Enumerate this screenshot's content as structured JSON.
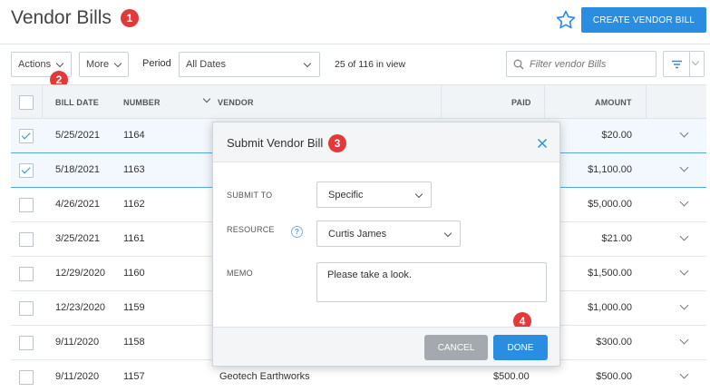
{
  "header": {
    "title": "Vendor Bills",
    "create_label": "CREATE VENDOR BILL",
    "icons": {
      "favorite": "star-icon"
    }
  },
  "badges": [
    "1",
    "2",
    "3",
    "4"
  ],
  "toolbar": {
    "actions_label": "Actions",
    "more_label": "More",
    "period_label": "Period",
    "period_value": "All Dates",
    "count_text": "25 of 116 in view",
    "search_placeholder": "Filter vendor Bills",
    "icons": {
      "search": "search-icon",
      "filter": "filter-icon"
    }
  },
  "table": {
    "columns": [
      "BILL DATE",
      "NUMBER",
      "VENDOR",
      "PAID",
      "AMOUNT"
    ],
    "rows": [
      {
        "date": "5/25/2021",
        "number": "1164",
        "vendor": "",
        "paid": "",
        "amount": "$20.00",
        "selected": true
      },
      {
        "date": "5/18/2021",
        "number": "1163",
        "vendor": "",
        "paid": "",
        "amount": "$1,100.00",
        "selected": true
      },
      {
        "date": "4/26/2021",
        "number": "1162",
        "vendor": "",
        "paid": "",
        "amount": "$5,000.00",
        "selected": false
      },
      {
        "date": "3/25/2021",
        "number": "1161",
        "vendor": "",
        "paid": "",
        "amount": "$21.00",
        "selected": false
      },
      {
        "date": "12/29/2020",
        "number": "1160",
        "vendor": "",
        "paid": "",
        "amount": "$1,500.00",
        "selected": false
      },
      {
        "date": "12/23/2020",
        "number": "1159",
        "vendor": "",
        "paid": "",
        "amount": "$1,000.00",
        "selected": false
      },
      {
        "date": "9/11/2020",
        "number": "1158",
        "vendor": "",
        "paid": "",
        "amount": "$300.00",
        "selected": false
      },
      {
        "date": "9/11/2020",
        "number": "1157",
        "vendor": "Geotech Earthworks",
        "paid": "$500.00",
        "amount": "$500.00",
        "selected": false
      }
    ]
  },
  "modal": {
    "title": "Submit Vendor Bill",
    "submit_to_label": "SUBMIT TO",
    "submit_to_value": "Specific",
    "resource_label": "RESOURCE",
    "resource_value": "Curtis James",
    "help_glyph": "?",
    "memo_label": "MEMO",
    "memo_value": "Please take a look.",
    "cancel_label": "CANCEL",
    "done_label": "DONE",
    "icons": {
      "close": "close-icon",
      "help": "help-icon"
    }
  },
  "colors": {
    "accent": "#2a8de0",
    "badge": "#e23a3a",
    "cancel": "#a3a9ae"
  }
}
